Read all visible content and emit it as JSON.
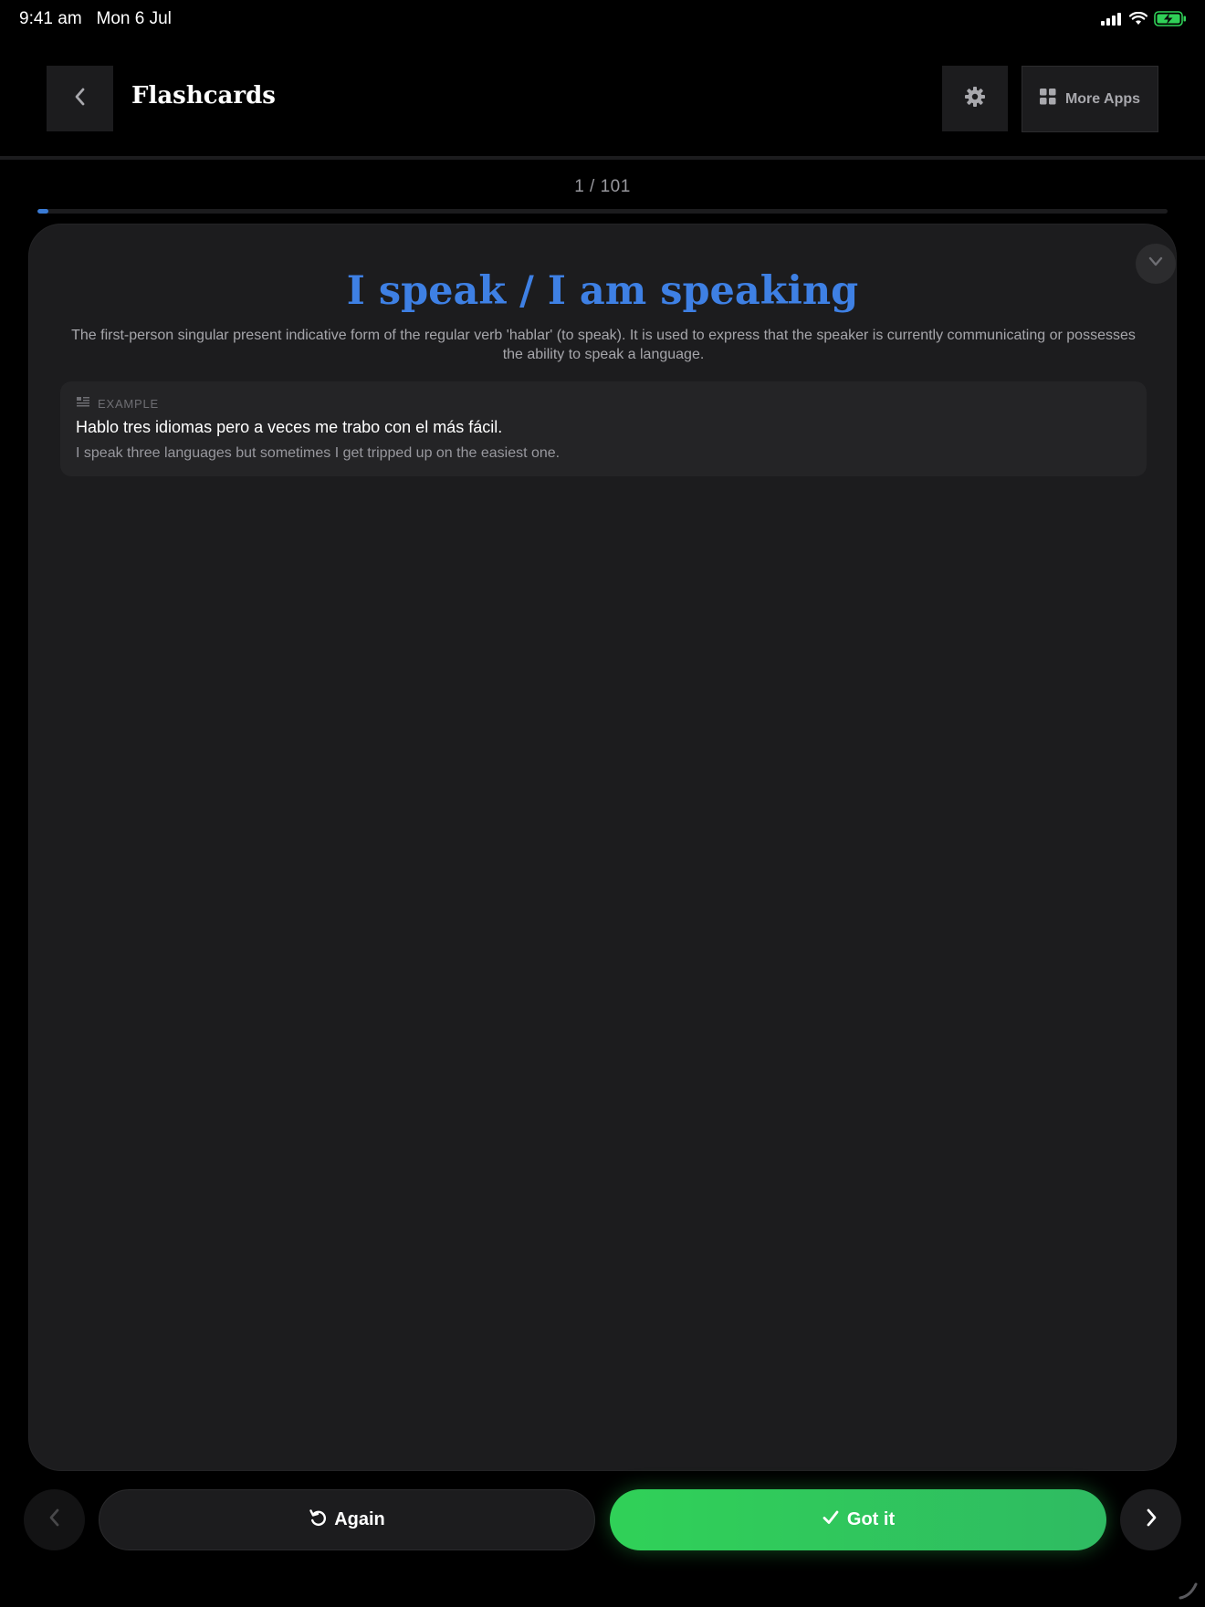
{
  "status_bar": {
    "time": "9:41 am",
    "date": "Mon 6 Jul",
    "icons": [
      "cellular-signal-icon",
      "wifi-icon",
      "battery-charging-icon"
    ]
  },
  "header": {
    "title": "Flashcards",
    "back_icon": "chevron-left-icon",
    "settings_icon": "gear-icon",
    "more_apps_label": "More Apps",
    "more_apps_icon": "grid-icon"
  },
  "progress": {
    "counter": "1 / 101",
    "current": 1,
    "total": 101,
    "fraction": 0.0099
  },
  "card": {
    "term": "I speak / I am speaking",
    "definition": "The first-person singular present indicative form of the regular verb 'hablar' (to speak). It is used to express that the speaker is currently communicating or possesses the ability to speak a language.",
    "collapse_icon": "chevron-down-icon",
    "example": {
      "label": "EXAMPLE",
      "icon": "text-lines-icon",
      "sentence": "Hablo tres idiomas pero a veces me trabo con el más fácil.",
      "translation": "I speak three languages but sometimes I get tripped up on the easiest one."
    }
  },
  "actions": {
    "again_label": "Again",
    "again_icon": "rotate-ccw-icon",
    "got_it_label": "Got it",
    "got_it_icon": "checkmark-icon",
    "prev_icon": "chevron-left-icon",
    "next_icon": "chevron-right-icon"
  },
  "colors": {
    "accent_blue": "#3e80e4",
    "success_green": "#30d158",
    "card_bg": "#1c1c1e",
    "page_bg": "#000000"
  }
}
